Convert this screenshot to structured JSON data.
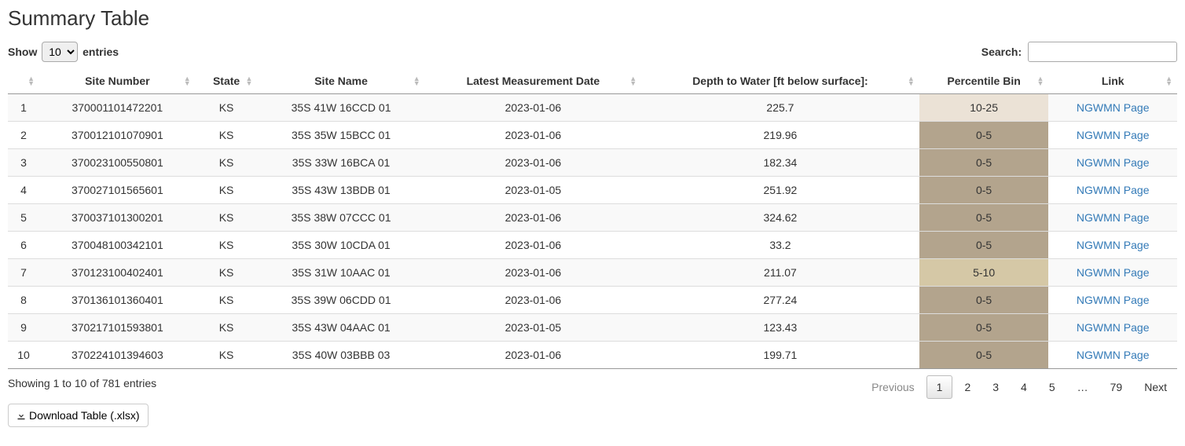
{
  "title": "Summary Table",
  "length_menu": {
    "prefix": "Show",
    "suffix": "entries",
    "selected": "10"
  },
  "search": {
    "label": "Search:",
    "value": ""
  },
  "columns": [
    "Site Number",
    "State",
    "Site Name",
    "Latest Measurement Date",
    "Depth to Water [ft below surface]:",
    "Percentile Bin",
    "Link"
  ],
  "rows": [
    {
      "n": "1",
      "site_number": "370001101472201",
      "state": "KS",
      "site_name": "35S 41W 16CCD 01",
      "date": "2023-01-06",
      "depth": "225.7",
      "pbin": "10-25",
      "pbin_class": "pbin-10-25",
      "link_text": "NGWMN Page"
    },
    {
      "n": "2",
      "site_number": "370012101070901",
      "state": "KS",
      "site_name": "35S 35W 15BCC 01",
      "date": "2023-01-06",
      "depth": "219.96",
      "pbin": "0-5",
      "pbin_class": "pbin-0-5",
      "link_text": "NGWMN Page"
    },
    {
      "n": "3",
      "site_number": "370023100550801",
      "state": "KS",
      "site_name": "35S 33W 16BCA 01",
      "date": "2023-01-06",
      "depth": "182.34",
      "pbin": "0-5",
      "pbin_class": "pbin-0-5",
      "link_text": "NGWMN Page"
    },
    {
      "n": "4",
      "site_number": "370027101565601",
      "state": "KS",
      "site_name": "35S 43W 13BDB 01",
      "date": "2023-01-05",
      "depth": "251.92",
      "pbin": "0-5",
      "pbin_class": "pbin-0-5",
      "link_text": "NGWMN Page"
    },
    {
      "n": "5",
      "site_number": "370037101300201",
      "state": "KS",
      "site_name": "35S 38W 07CCC 01",
      "date": "2023-01-06",
      "depth": "324.62",
      "pbin": "0-5",
      "pbin_class": "pbin-0-5",
      "link_text": "NGWMN Page"
    },
    {
      "n": "6",
      "site_number": "370048100342101",
      "state": "KS",
      "site_name": "35S 30W 10CDA 01",
      "date": "2023-01-06",
      "depth": "33.2",
      "pbin": "0-5",
      "pbin_class": "pbin-0-5",
      "link_text": "NGWMN Page"
    },
    {
      "n": "7",
      "site_number": "370123100402401",
      "state": "KS",
      "site_name": "35S 31W 10AAC 01",
      "date": "2023-01-06",
      "depth": "211.07",
      "pbin": "5-10",
      "pbin_class": "pbin-5-10",
      "link_text": "NGWMN Page"
    },
    {
      "n": "8",
      "site_number": "370136101360401",
      "state": "KS",
      "site_name": "35S 39W 06CDD 01",
      "date": "2023-01-06",
      "depth": "277.24",
      "pbin": "0-5",
      "pbin_class": "pbin-0-5",
      "link_text": "NGWMN Page"
    },
    {
      "n": "9",
      "site_number": "370217101593801",
      "state": "KS",
      "site_name": "35S 43W 04AAC 01",
      "date": "2023-01-05",
      "depth": "123.43",
      "pbin": "0-5",
      "pbin_class": "pbin-0-5",
      "link_text": "NGWMN Page"
    },
    {
      "n": "10",
      "site_number": "370224101394603",
      "state": "KS",
      "site_name": "35S 40W 03BBB 03",
      "date": "2023-01-06",
      "depth": "199.71",
      "pbin": "0-5",
      "pbin_class": "pbin-0-5",
      "link_text": "NGWMN Page"
    }
  ],
  "info_text": "Showing 1 to 10 of 781 entries",
  "pagination": {
    "previous": "Previous",
    "next": "Next",
    "pages": [
      "1",
      "2",
      "3",
      "4",
      "5"
    ],
    "ellipsis": "…",
    "last": "79",
    "current": "1"
  },
  "download_label": "Download Table (.xlsx)"
}
